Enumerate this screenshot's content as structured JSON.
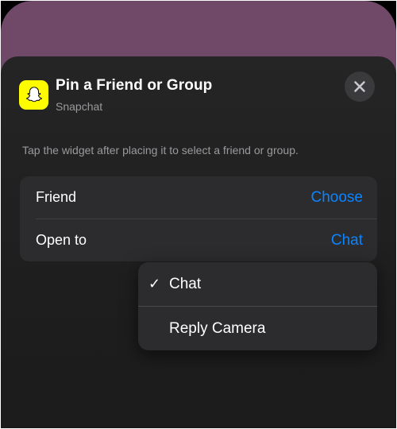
{
  "widget": {
    "title": "Pin a Friend or Group",
    "app_name": "Snapchat",
    "app_icon": "snapchat-ghost-icon",
    "close_icon": "close-icon",
    "instruction": "Tap the widget after placing it to select a friend or group."
  },
  "settings": {
    "rows": [
      {
        "label": "Friend",
        "value": "Choose"
      },
      {
        "label": "Open to",
        "value": "Chat"
      }
    ]
  },
  "dropdown": {
    "selected_index": 0,
    "items": [
      {
        "label": "Chat",
        "check": "✓"
      },
      {
        "label": "Reply Camera"
      }
    ]
  },
  "colors": {
    "accent": "#0a84ff",
    "snapchat_yellow": "#FFFC00",
    "wallpaper": "#704868",
    "sheet": "#252525",
    "card": "#2c2c2e"
  }
}
